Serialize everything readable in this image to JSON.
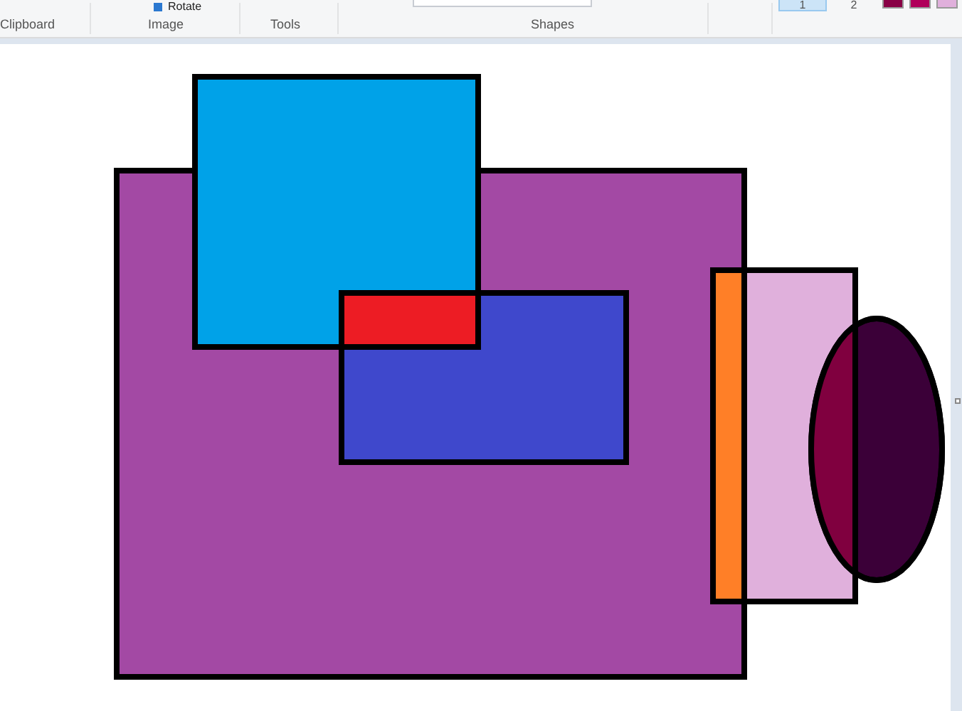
{
  "ribbon": {
    "rotate_label": "Rotate",
    "groups": [
      "Clipboard",
      "Image",
      "Tools",
      "Shapes"
    ],
    "sizes": [
      {
        "label": "1",
        "selected": true
      },
      {
        "label": "2",
        "selected": false
      }
    ],
    "swatches": [
      {
        "color": "#880045"
      },
      {
        "color": "#b0005a"
      },
      {
        "color": "#e0b0dc"
      }
    ]
  }
}
